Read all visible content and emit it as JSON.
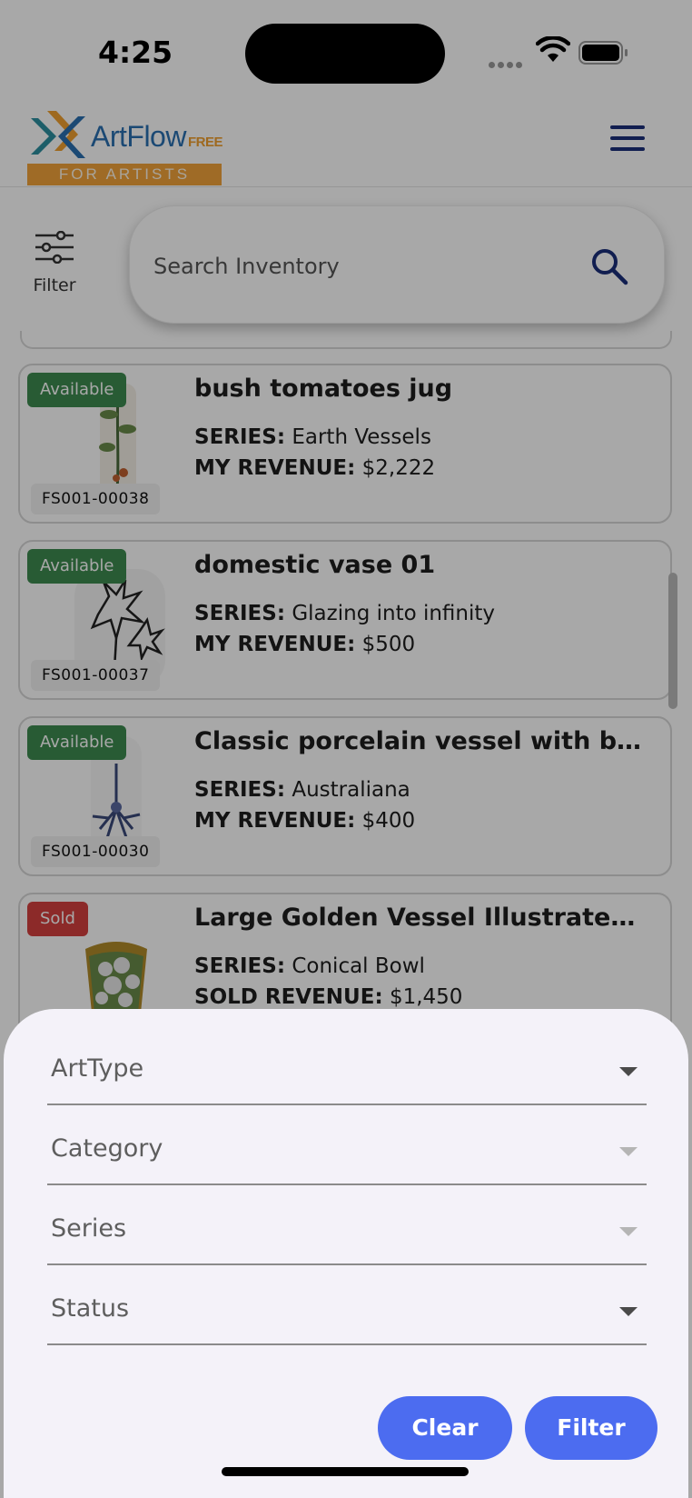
{
  "status_bar": {
    "time": "4:25"
  },
  "header": {
    "logo_name": "ArtFlow",
    "logo_edition": "FREE",
    "logo_tagline": "FOR ARTISTS",
    "menu_icon": "hamburger-icon"
  },
  "toolbar": {
    "filter_label": "Filter",
    "filter_icon": "sliders-icon",
    "search_placeholder": "Search Inventory",
    "search_icon": "search-icon"
  },
  "inventory": [
    {
      "status": "Available",
      "sku": "FS001-00038",
      "title": "bush tomatoes jug",
      "series_label": "SERIES:",
      "series": "Earth Vessels",
      "revenue_label": "MY REVENUE:",
      "revenue": "$2,222"
    },
    {
      "status": "Available",
      "sku": "FS001-00037",
      "title": "domestic vase 01",
      "series_label": "SERIES:",
      "series": "Glazing into infinity",
      "revenue_label": "MY REVENUE:",
      "revenue": "$500"
    },
    {
      "status": "Available",
      "sku": "FS001-00030",
      "title": "Classic porcelain vessel with blu...",
      "series_label": "SERIES:",
      "series": "Australiana",
      "revenue_label": "MY REVENUE:",
      "revenue": "$400"
    },
    {
      "status": "Sold",
      "sku": "",
      "title": "Large Golden Vessel Illustrated ...",
      "series_label": "SERIES:",
      "series": "Conical Bowl",
      "revenue_label": "SOLD REVENUE:",
      "revenue": "$1,450"
    }
  ],
  "filter_sheet": {
    "dropdowns": [
      {
        "label": "ArtType",
        "enabled": true
      },
      {
        "label": "Category",
        "enabled": false
      },
      {
        "label": "Series",
        "enabled": false
      },
      {
        "label": "Status",
        "enabled": true
      }
    ],
    "clear_label": "Clear",
    "filter_label": "Filter"
  },
  "colors": {
    "primary_button": "#4c6cf0",
    "available_badge": "#3d8a4f",
    "sold_badge": "#d5403f",
    "menu_icon": "#1a2e7a",
    "sheet_background": "#f4f2f9"
  }
}
